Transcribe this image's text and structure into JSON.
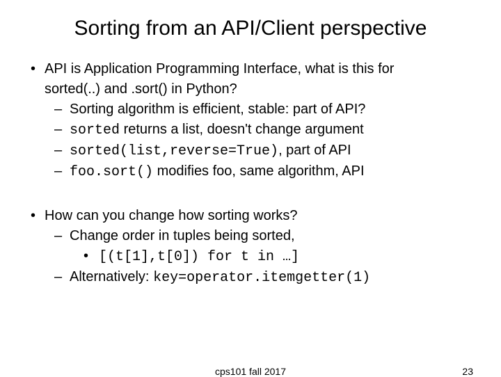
{
  "title": "Sorting from an API/Client perspective",
  "b1": {
    "line1": "API is Application Programming Interface, what is this for",
    "line2": "sorted(..) and .sort() in Python?",
    "s1": "Sorting algorithm is efficient, stable: part of API?",
    "s2a": "sorted",
    "s2b": " returns a list, doesn't change argument",
    "s3a": "sorted(list,reverse=True)",
    "s3b": ", part of API",
    "s4a": "foo.sort()",
    "s4b": " modifies foo, same algorithm, API"
  },
  "b2": {
    "line1": "How can you change how sorting works?",
    "s1": "Change order in tuples being sorted,",
    "s1a": "[(t[1],t[0]) for t in …]",
    "s2a": "Alternatively: ",
    "s2b": "key=operator.itemgetter(1)"
  },
  "footer": {
    "center": "cps101 fall 2017",
    "page": "23"
  }
}
